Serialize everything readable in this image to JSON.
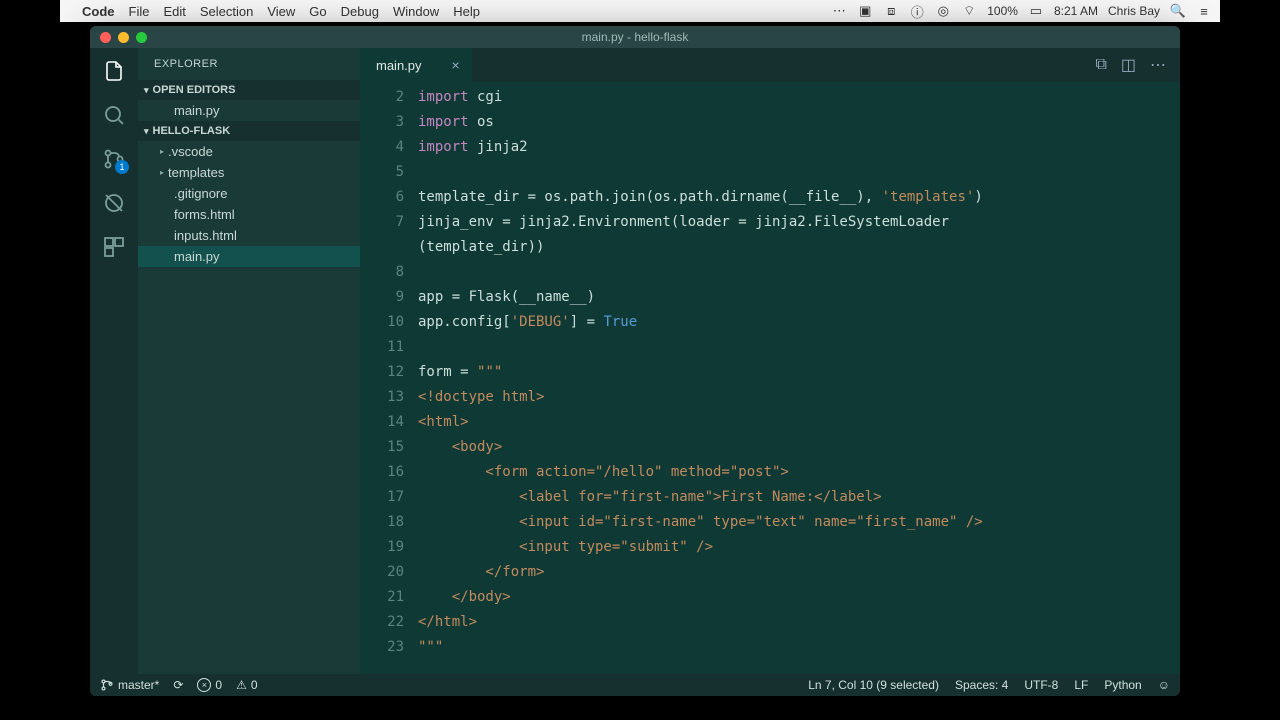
{
  "mac_menu": {
    "app": "Code",
    "items": [
      "File",
      "Edit",
      "Selection",
      "View",
      "Go",
      "Debug",
      "Window",
      "Help"
    ],
    "right": {
      "battery": "100%",
      "time": "8:21 AM",
      "user": "Chris Bay"
    }
  },
  "window_title": "main.py - hello-flask",
  "explorer": {
    "title": "EXPLORER",
    "open_editors_label": "OPEN EDITORS",
    "open_editors": [
      "main.py"
    ],
    "project_label": "HELLO-FLASK",
    "tree": [
      {
        "type": "folder",
        "name": ".vscode",
        "expanded": false
      },
      {
        "type": "folder",
        "name": "templates",
        "expanded": false
      },
      {
        "type": "file",
        "name": ".gitignore"
      },
      {
        "type": "file",
        "name": "forms.html"
      },
      {
        "type": "file",
        "name": "inputs.html"
      },
      {
        "type": "file",
        "name": "main.py",
        "selected": true
      }
    ]
  },
  "tabs": [
    {
      "name": "main.py",
      "dirty": true,
      "active": true
    }
  ],
  "git_badge": "1",
  "code": {
    "first_line": 2,
    "lines": [
      [
        {
          "t": "import",
          "c": "kw"
        },
        {
          "t": " cgi",
          "c": "ident"
        }
      ],
      [
        {
          "t": "import",
          "c": "kw"
        },
        {
          "t": " os",
          "c": "ident"
        }
      ],
      [
        {
          "t": "import",
          "c": "kw"
        },
        {
          "t": " jinja2",
          "c": "ident"
        }
      ],
      [],
      [
        {
          "t": "template_dir = os.path.join(os.path.dirname(__file__), ",
          "c": "ident"
        },
        {
          "t": "'templates'",
          "c": "str"
        },
        {
          "t": ")",
          "c": "ident"
        }
      ],
      [
        {
          "t": "jinja_env = jinja2.Environment(loader = jinja2.FileSystemLoader",
          "c": "ident"
        }
      ],
      [
        {
          "t": "(template_dir))",
          "c": "ident"
        }
      ],
      [],
      [
        {
          "t": "app = Flask(__name__)",
          "c": "ident"
        }
      ],
      [
        {
          "t": "app.config[",
          "c": "ident"
        },
        {
          "t": "'DEBUG'",
          "c": "str"
        },
        {
          "t": "] = ",
          "c": "ident"
        },
        {
          "t": "True",
          "c": "bool"
        }
      ],
      [],
      [
        {
          "t": "form = ",
          "c": "ident"
        },
        {
          "t": "\"\"\"",
          "c": "str"
        }
      ],
      [
        {
          "t": "<!doctype html>",
          "c": "str"
        }
      ],
      [
        {
          "t": "<html>",
          "c": "str"
        }
      ],
      [
        {
          "t": "    <body>",
          "c": "str"
        }
      ],
      [
        {
          "t": "        <form action=\"/hello\" method=\"post\">",
          "c": "str"
        }
      ],
      [
        {
          "t": "            <label for=\"first-name\">First Name:</label>",
          "c": "str"
        }
      ],
      [
        {
          "t": "            <input id=\"first-name\" type=\"text\" name=\"first_name\" />",
          "c": "str"
        }
      ],
      [
        {
          "t": "            <input type=\"submit\" />",
          "c": "str"
        }
      ],
      [
        {
          "t": "        </form>",
          "c": "str"
        }
      ],
      [
        {
          "t": "    </body>",
          "c": "str"
        }
      ],
      [
        {
          "t": "</html>",
          "c": "str"
        }
      ],
      [
        {
          "t": "\"\"\"",
          "c": "str"
        }
      ]
    ],
    "wrapped_continuations": [
      6
    ]
  },
  "statusbar": {
    "branch": "master*",
    "errors": "0",
    "warnings": "0",
    "cursor": "Ln 7, Col 10 (9 selected)",
    "spaces": "Spaces: 4",
    "encoding": "UTF-8",
    "eol": "LF",
    "lang": "Python"
  }
}
